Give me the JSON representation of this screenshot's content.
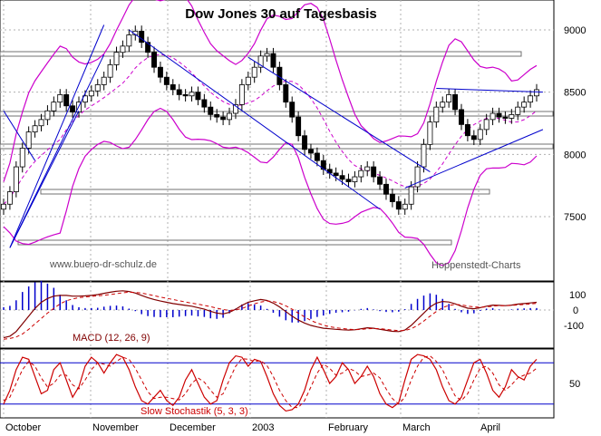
{
  "chart_data": [
    {
      "type": "line",
      "title": "Dow Jones 30 auf Tagesbasis",
      "subtype": "ohlc-candlestick with Bollinger bands and trendlines",
      "yticks": [
        9000,
        8500,
        8000,
        7500
      ],
      "ylim": [
        7100,
        9250
      ],
      "grid": true,
      "x_labels": [
        "October",
        "November",
        "December",
        "2003",
        "February",
        "March",
        "April"
      ],
      "watermark_left": "www.buero-dr-schulz.de",
      "watermark_right": "Hoppenstedt-Charts",
      "colors": {
        "price": "#000000",
        "bollinger": "#cc00cc",
        "trendline": "#0000cc",
        "support": "#808080"
      },
      "close": [
        7600,
        7700,
        7900,
        8050,
        8180,
        8230,
        8280,
        8350,
        8420,
        8480,
        8390,
        8340,
        8420,
        8470,
        8510,
        8560,
        8620,
        8720,
        8820,
        8870,
        8960,
        8990,
        8900,
        8820,
        8700,
        8620,
        8560,
        8520,
        8480,
        8470,
        8500,
        8440,
        8380,
        8320,
        8300,
        8280,
        8330,
        8400,
        8560,
        8620,
        8700,
        8790,
        8810,
        8700,
        8560,
        8420,
        8300,
        8150,
        8040,
        8010,
        7950,
        7880,
        7850,
        7830,
        7800,
        7780,
        7820,
        7870,
        7900,
        7820,
        7760,
        7680,
        7620,
        7560,
        7600,
        7740,
        7900,
        8080,
        8260,
        8380,
        8420,
        8480,
        8360,
        8240,
        8150,
        8120,
        8200,
        8280,
        8330,
        8300,
        8290,
        8320,
        8380,
        8420,
        8470,
        8520
      ]
    },
    {
      "type": "line",
      "title": "MACD (12, 26, 9)",
      "yticks": [
        100,
        0,
        -100
      ],
      "colors": {
        "macd": "#800000",
        "signal": "#cc0000",
        "histogram": "#0000cc"
      },
      "macd": [
        -180,
        -170,
        -140,
        -90,
        -40,
        10,
        50,
        75,
        90,
        95,
        95,
        90,
        90,
        92,
        95,
        100,
        108,
        115,
        122,
        125,
        120,
        110,
        95,
        80,
        68,
        58,
        50,
        42,
        36,
        30,
        25,
        15,
        5,
        -8,
        -20,
        -25,
        -15,
        5,
        30,
        50,
        60,
        68,
        62,
        45,
        20,
        -10,
        -40,
        -65,
        -85,
        -100,
        -110,
        -118,
        -122,
        -125,
        -128,
        -130,
        -128,
        -122,
        -115,
        -118,
        -125,
        -132,
        -138,
        -140,
        -130,
        -100,
        -60,
        -20,
        20,
        45,
        55,
        52,
        40,
        25,
        12,
        8,
        15,
        25,
        32,
        30,
        28,
        32,
        38,
        42,
        46,
        50
      ],
      "signal": [
        -190,
        -185,
        -175,
        -155,
        -125,
        -90,
        -55,
        -20,
        10,
        40,
        60,
        72,
        80,
        85,
        88,
        92,
        96,
        100,
        106,
        112,
        115,
        114,
        110,
        102,
        93,
        84,
        76,
        68,
        60,
        52,
        45,
        38,
        30,
        22,
        12,
        3,
        -3,
        0,
        10,
        25,
        40,
        52,
        58,
        55,
        44,
        27,
        5,
        -20,
        -45,
        -68,
        -85,
        -98,
        -108,
        -115,
        -120,
        -124,
        -127,
        -126,
        -122,
        -120,
        -121,
        -125,
        -130,
        -134,
        -133,
        -122,
        -100,
        -72,
        -40,
        -10,
        15,
        30,
        36,
        33,
        26,
        20,
        18,
        20,
        25,
        28,
        28,
        30,
        33,
        36,
        39,
        43
      ]
    },
    {
      "type": "line",
      "title": "Slow Stochastik (5, 3, 3)",
      "yticks": [
        50
      ],
      "colors": {
        "k": "#cc0000",
        "d": "#cc0000",
        "bands": "#0000cc"
      },
      "k": [
        20,
        40,
        70,
        88,
        85,
        60,
        35,
        40,
        70,
        80,
        55,
        30,
        45,
        75,
        88,
        80,
        65,
        80,
        92,
        88,
        70,
        45,
        25,
        20,
        30,
        40,
        25,
        18,
        30,
        55,
        70,
        50,
        30,
        20,
        25,
        55,
        80,
        90,
        88,
        75,
        85,
        82,
        60,
        35,
        18,
        10,
        12,
        20,
        40,
        70,
        88,
        70,
        50,
        60,
        80,
        70,
        50,
        60,
        75,
        60,
        35,
        20,
        15,
        22,
        55,
        85,
        92,
        90,
        85,
        70,
        45,
        25,
        20,
        30,
        55,
        80,
        85,
        65,
        40,
        30,
        45,
        70,
        60,
        55,
        75,
        85
      ],
      "d": [
        25,
        30,
        50,
        70,
        82,
        75,
        58,
        45,
        50,
        62,
        62,
        48,
        42,
        55,
        70,
        80,
        78,
        75,
        82,
        88,
        85,
        72,
        55,
        38,
        28,
        30,
        30,
        28,
        26,
        35,
        50,
        58,
        52,
        40,
        30,
        35,
        55,
        75,
        86,
        85,
        82,
        83,
        76,
        60,
        40,
        25,
        15,
        15,
        25,
        45,
        65,
        78,
        72,
        62,
        65,
        72,
        68,
        60,
        62,
        65,
        58,
        42,
        28,
        20,
        30,
        55,
        75,
        88,
        90,
        82,
        70,
        50,
        32,
        25,
        35,
        55,
        72,
        75,
        65,
        48,
        40,
        48,
        58,
        62,
        65,
        72
      ]
    }
  ]
}
